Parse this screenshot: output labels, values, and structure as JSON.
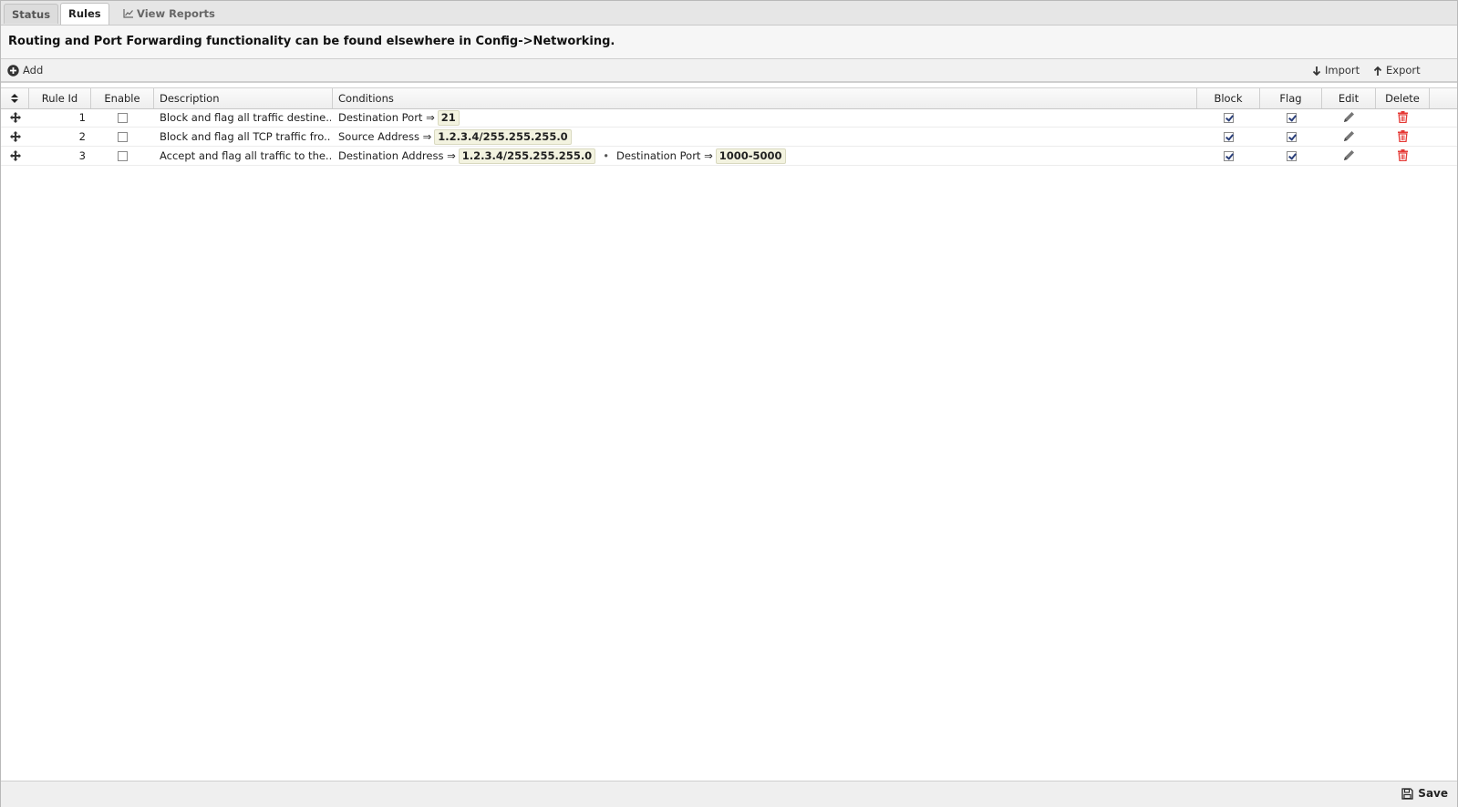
{
  "tabs": [
    {
      "label": "Status"
    },
    {
      "label": "Rules"
    },
    {
      "label": "View Reports"
    }
  ],
  "notice": "Routing and Port Forwarding functionality can be found elsewhere in Config->Networking.",
  "toolbar": {
    "add_label": "Add",
    "import_label": "Import",
    "export_label": "Export"
  },
  "columns": {
    "rule_id": "Rule Id",
    "enable": "Enable",
    "description": "Description",
    "conditions": "Conditions",
    "block": "Block",
    "flag": "Flag",
    "edit": "Edit",
    "delete": "Delete"
  },
  "rules": [
    {
      "id": "1",
      "enabled": false,
      "description": "Block and flag all traffic destine...",
      "conditions": [
        {
          "name": "Destination Port ⇒",
          "value": "21"
        }
      ],
      "block": true,
      "flag": true
    },
    {
      "id": "2",
      "enabled": false,
      "description": "Block and flag all TCP traffic fro...",
      "conditions": [
        {
          "name": "Source Address ⇒",
          "value": "1.2.3.4/255.255.255.0"
        }
      ],
      "block": true,
      "flag": true
    },
    {
      "id": "3",
      "enabled": false,
      "description": "Accept and flag all traffic to the...",
      "conditions": [
        {
          "name": "Destination Address ⇒",
          "value": "1.2.3.4/255.255.255.0"
        },
        {
          "name": "Destination Port ⇒",
          "value": "1000-5000"
        }
      ],
      "condition_separator": "•",
      "block": true,
      "flag": true
    }
  ],
  "footer": {
    "save_label": "Save"
  },
  "colors": {
    "delete_icon": "#e53935",
    "checkmark": "#2a3f7a"
  }
}
